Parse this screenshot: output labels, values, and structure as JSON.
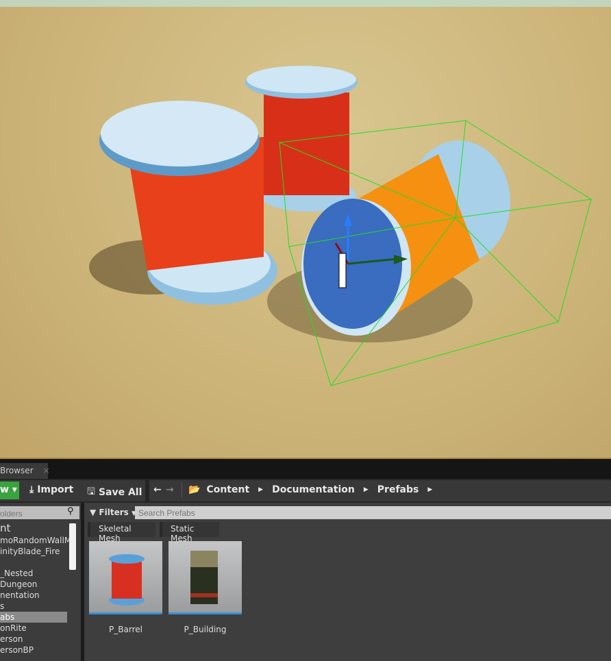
{
  "viewport": {
    "selection_color": "#22dd22",
    "gizmo": "translate-gizmo"
  },
  "tab": {
    "title": "Browser",
    "close": "×"
  },
  "toolbar": {
    "new_label": "w ▾",
    "import_label": "Import",
    "save_all_label": "Save All",
    "breadcrumb": [
      "Content",
      "Documentation",
      "Prefabs"
    ]
  },
  "sources": {
    "search_placeholder": "olders",
    "items": [
      "nt",
      "moRandomWallM",
      "inityBlade_Fire",
      "",
      "_Nested",
      "Dungeon",
      "nentation",
      "s",
      "abs",
      "onRite",
      "erson",
      "ersonBP"
    ],
    "selected_index": 8
  },
  "content": {
    "filters_label": "Filters",
    "search_placeholder": "Search Prefabs",
    "filter_chips": [
      "Skeletal Mesh",
      "Static Mesh"
    ],
    "assets": [
      {
        "name": "P_Barrel"
      },
      {
        "name": "P_Building"
      }
    ]
  },
  "colors": {
    "accent_green": "#3aa33e",
    "selection_blue": "#3b8fd6"
  }
}
